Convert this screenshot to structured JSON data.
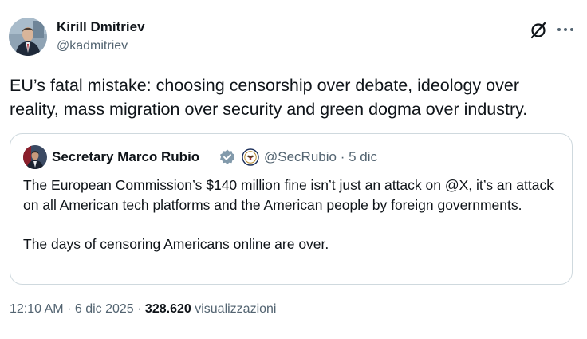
{
  "author": {
    "name": "Kirill Dmitriev",
    "handle": "@kadmitriev"
  },
  "post": {
    "text": "EU’s fatal mistake: choosing censorship over debate, ideology over reality, mass migration over security and green dogma over industry."
  },
  "quote": {
    "name": "Secretary Marco Rubio",
    "handle": "@SecRubio",
    "separator": "·",
    "date": "5 dic",
    "paragraphs": [
      "The European Commission’s $140 million fine isn’t just an attack on @X, it’s an attack on all American tech platforms and the American people by foreign governments.",
      "The days of censoring Americans online are over."
    ]
  },
  "footer": {
    "time": "12:10 AM",
    "separator": "·",
    "date": "6 dic 2025",
    "views_count": "328.620",
    "views_label": "visualizzazioni"
  },
  "icons": {
    "verified_badge": "verified-badge-icon",
    "grok": "grok-icon",
    "more": "more-dots-icon",
    "gov_seal": "government-seal-icon"
  },
  "colors": {
    "text": "#0f1419",
    "secondary": "#536471",
    "border": "#cfd9de",
    "verified_gray": "#829aab"
  }
}
